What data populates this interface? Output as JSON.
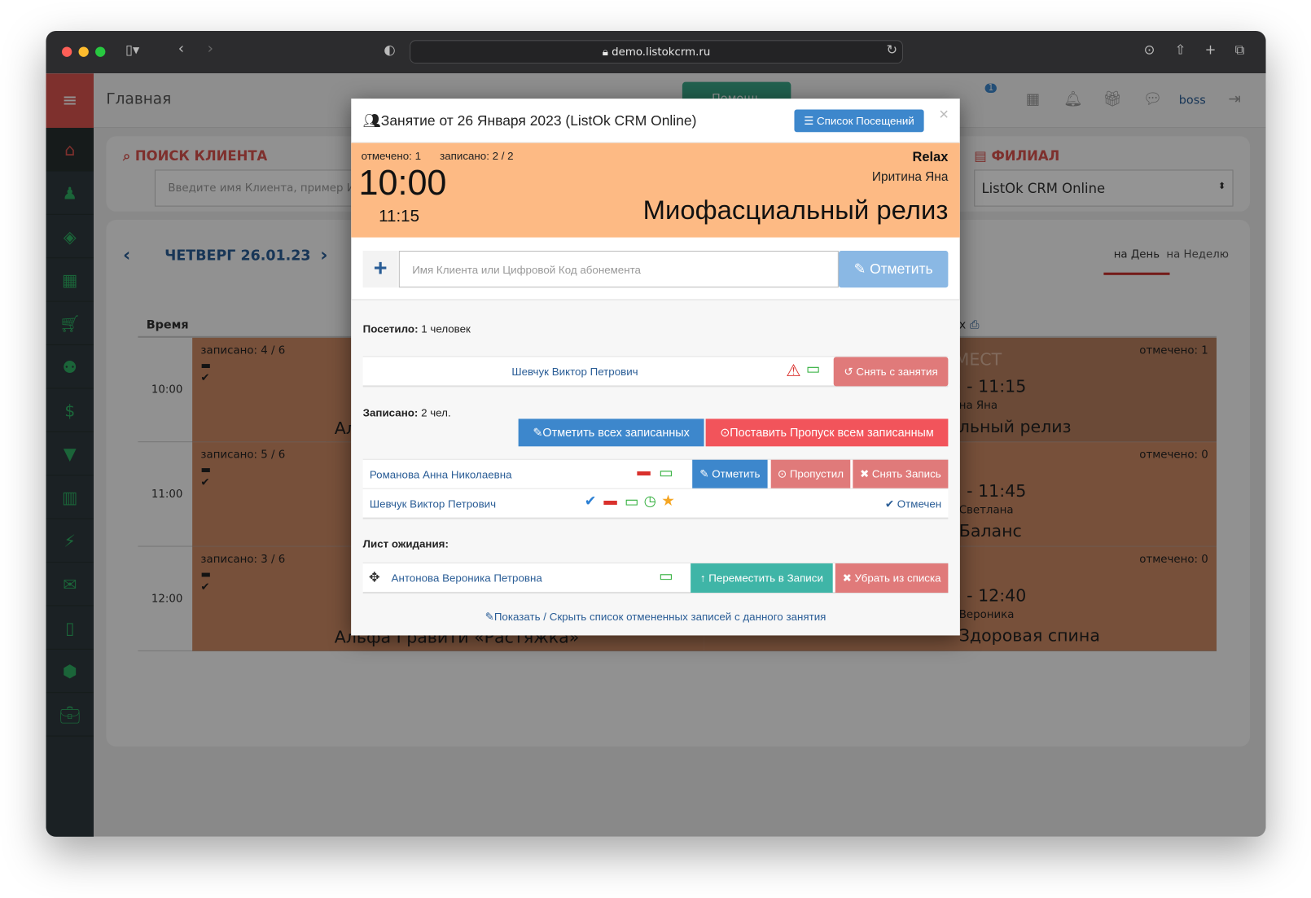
{
  "browser": {
    "url": "demo.listokcrm.ru"
  },
  "header": {
    "title": "Главная",
    "help_label": "Помощь",
    "user": "boss",
    "notif_count": "1"
  },
  "sidebar": {
    "items": [
      "home-icon",
      "person-icon",
      "cube-icon",
      "calendar-icon",
      "cart-icon",
      "users-icon",
      "dollar-icon",
      "filter-icon",
      "chart-icon",
      "plug-icon",
      "mail-icon",
      "mobile-icon",
      "cubes-icon",
      "briefcase-icon"
    ]
  },
  "search": {
    "title": "ПОИСК КЛИЕНТА",
    "placeholder": "Введите имя Клиента, пример Иван"
  },
  "branch": {
    "title": "ФИЛИАЛ",
    "value": "ListOk CRM Online"
  },
  "calendar": {
    "date": "ЧЕТВЕРГ 26.01.23",
    "view_day": "на День",
    "view_week": "на Неделю",
    "time_header": "Время",
    "rows": [
      {
        "time": "10:00",
        "left_info": "записано: 4 / 6",
        "left_title": "Ал",
        "right_marked": "отмечено: 1",
        "right_places": "МЕСТ",
        "right_time": ") - 11:15",
        "right_teacher": "на Яна",
        "right_title": "льный релиз"
      },
      {
        "time": "11:00",
        "left_info": "записано: 5 / 6",
        "left_title": "",
        "right_marked": "отмечено: 0",
        "right_time": ") - 11:45",
        "right_teacher": "Светлана",
        "right_title": "Баланс"
      },
      {
        "time": "12:00",
        "left_info": "записано: 3 / 6",
        "left_title": "Альфа Гравити «Растяжка»",
        "right_marked": "отмечено: 0",
        "right_time": ") - 12:40",
        "right_teacher": "Вероника",
        "right_title": "Здоровая спина"
      }
    ],
    "print_fragment": "х"
  },
  "modal": {
    "title": "Занятие от 26 Января 2023 (ListOk CRM Online)",
    "attendance_list_button": "Список Посещений",
    "close": "×",
    "lesson": {
      "marked": "отмечено: 1",
      "enrolled": "записано: 2 / 2",
      "start": "10:00",
      "end": "11:15",
      "room": "Relax",
      "teacher": "Иритина Яна",
      "name": "Миофасциальный релиз",
      "color": "#fdba84"
    },
    "input_placeholder": "Имя Клиента или Цифровой Код абонемента",
    "mark_button": "Отметить",
    "visited": {
      "label": "Посетило:",
      "value": "1 человек",
      "items": [
        {
          "name": "Шевчук Виктор Петрович",
          "action": "Снять с занятия"
        }
      ]
    },
    "enrolled": {
      "label": "Записано:",
      "value": "2 чел.",
      "mark_all": "Отметить всех записанных",
      "skip_all": "Поставить Пропуск всем записанным",
      "items": [
        {
          "name": "Романова Анна Николаевна",
          "mark": "Отметить",
          "skip": "Пропустил",
          "remove": "Снять Запись"
        },
        {
          "name": "Шевчук Виктор Петрович",
          "status": "Отмечен"
        }
      ]
    },
    "waitlist": {
      "label": "Лист ожидания:",
      "items": [
        {
          "name": "Антонова Вероника Петровна",
          "move": "Переместить в Записи",
          "remove": "Убрать из списка"
        }
      ]
    },
    "toggle_cancelled": "Показать / Скрыть список отмененных записей с данного занятия"
  }
}
